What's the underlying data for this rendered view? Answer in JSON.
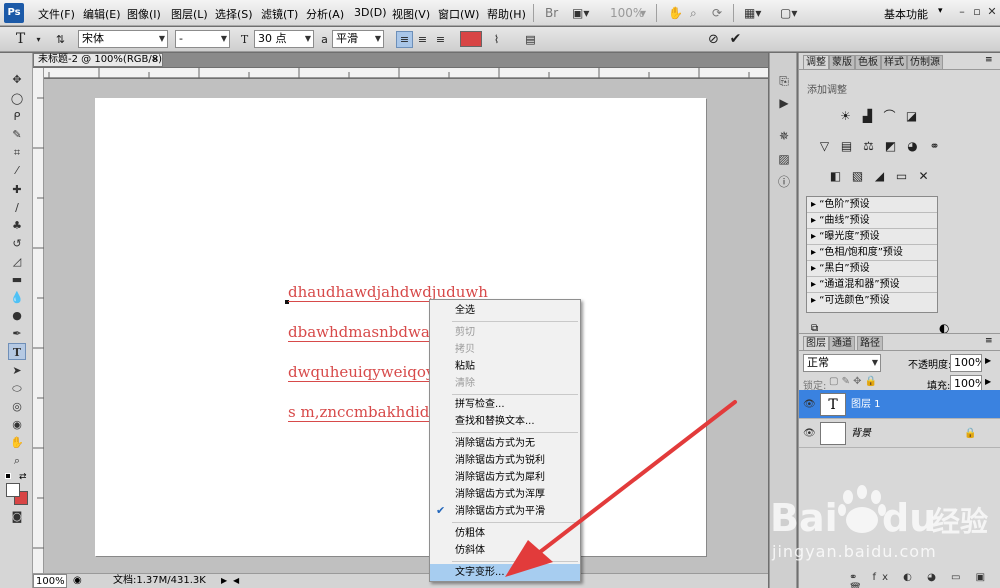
{
  "app": {
    "logo": "Ps",
    "workspace": "基本功能"
  },
  "menu": [
    "文件(F)",
    "编辑(E)",
    "图像(I)",
    "图层(L)",
    "选择(S)",
    "滤镜(T)",
    "分析(A)",
    "3D(D)",
    "视图(V)",
    "窗口(W)",
    "帮助(H)"
  ],
  "menubar_icons": [
    "br-icon",
    "frame-icon",
    "zoom-level-icon",
    "hand-icon",
    "zoom-tool-icon",
    "rotate-icon",
    "arrange-icon",
    "screen-mode-icon"
  ],
  "zoom_display": "100%",
  "options": {
    "font_family": "宋体",
    "font_style": "-",
    "font_size": "30 点",
    "aa_label": "a",
    "antialias": "平滑",
    "text_color": "#d84545"
  },
  "document": {
    "tab_title": "未标题-2 @ 100%(RGB/8)",
    "lines": [
      "dhaudhawdjahdwdjuduwh",
      "dbawhdmasnbdwabr",
      "dwquheuiqyweiqoy",
      "s m,znccmbakhdid"
    ]
  },
  "status": {
    "zoom": "100%",
    "doc_info": "文档:1.37M/431.3K"
  },
  "context_menu": {
    "items": [
      {
        "label": "全选",
        "disabled": false
      },
      {
        "label": "剪切",
        "disabled": true
      },
      {
        "label": "拷贝",
        "disabled": true
      },
      {
        "label": "粘贴",
        "disabled": false
      },
      {
        "label": "清除",
        "disabled": true
      },
      {
        "label": "拼写检查...",
        "disabled": false
      },
      {
        "label": "查找和替换文本...",
        "disabled": false
      },
      {
        "label": "消除锯齿方式为无",
        "disabled": false
      },
      {
        "label": "消除锯齿方式为锐利",
        "disabled": false
      },
      {
        "label": "消除锯齿方式为犀利",
        "disabled": false
      },
      {
        "label": "消除锯齿方式为浑厚",
        "disabled": false
      },
      {
        "label": "消除锯齿方式为平滑",
        "disabled": false,
        "checked": true
      },
      {
        "label": "仿粗体",
        "disabled": false
      },
      {
        "label": "仿斜体",
        "disabled": false
      },
      {
        "label": "文字变形...",
        "disabled": false,
        "highlighted": true
      }
    ]
  },
  "adjustments": {
    "tabs": [
      "调整",
      "蒙版",
      "色板",
      "样式",
      "仿制源"
    ],
    "subtitle": "添加调整",
    "presets": [
      "“色阶”预设",
      "“曲线”预设",
      "“曝光度”预设",
      "“色相/饱和度”预设",
      "“黑白”预设",
      "“通道混和器”预设",
      "“可选颜色”预设"
    ]
  },
  "layers": {
    "tabs": [
      "图层",
      "通道",
      "路径"
    ],
    "blend_mode": "正常",
    "opacity_label": "不透明度:",
    "opacity": "100%",
    "lock_label": "锁定:",
    "fill_label": "填充:",
    "fill": "100%",
    "items": [
      {
        "name": "图层 1",
        "thumb": "T",
        "selected": true
      },
      {
        "name": "背景",
        "thumb": "",
        "selected": false
      }
    ]
  },
  "watermark": {
    "brand": "Bai",
    "brand2": "du",
    "brand_cn": "经验",
    "url": "jingyan.baidu.com"
  },
  "colors": {
    "arrow": "#e23b3b",
    "text": "#d74a4a",
    "selection": "#3a82e0"
  }
}
